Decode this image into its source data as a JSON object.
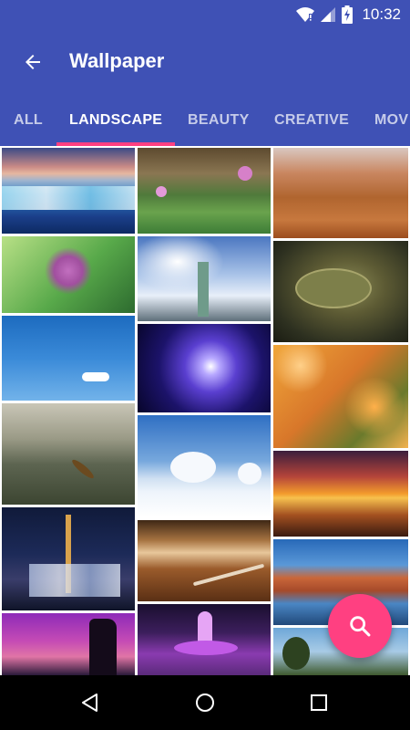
{
  "status_bar": {
    "time": "10:32"
  },
  "app_bar": {
    "title": "Wallpaper"
  },
  "tabs": [
    {
      "label": "ALL",
      "active": false
    },
    {
      "label": "LANDSCAPE",
      "active": true
    },
    {
      "label": "BEAUTY",
      "active": false
    },
    {
      "label": "CREATIVE",
      "active": false
    },
    {
      "label": "MOV",
      "active": false
    }
  ],
  "colors": {
    "primary": "#3f51b5",
    "accent": "#ff4081",
    "nav_bar": "#000000"
  },
  "icons": {
    "back": "arrow-left-icon",
    "search": "search-icon",
    "wifi": "wifi-icon",
    "signal": "signal-icon",
    "battery": "battery-icon",
    "nav_back": "triangle-back-icon",
    "nav_home": "circle-home-icon",
    "nav_recents": "square-recents-icon"
  },
  "wallpapers": [
    "glacier-lake",
    "temple-lotus-pond",
    "desert-dunes",
    "purple-flower",
    "statue-of-liberty",
    "sea-turtle",
    "blue-sky-cloud",
    "galaxy",
    "orange-lilies",
    "misty-lake-canoe",
    "snowy-trees",
    "sunset-beach",
    "night-city-tower",
    "desert-road-sunset",
    "red-mountains-lake",
    "purple-sky-rocks",
    "illuminated-fountain",
    "tree-lake"
  ]
}
